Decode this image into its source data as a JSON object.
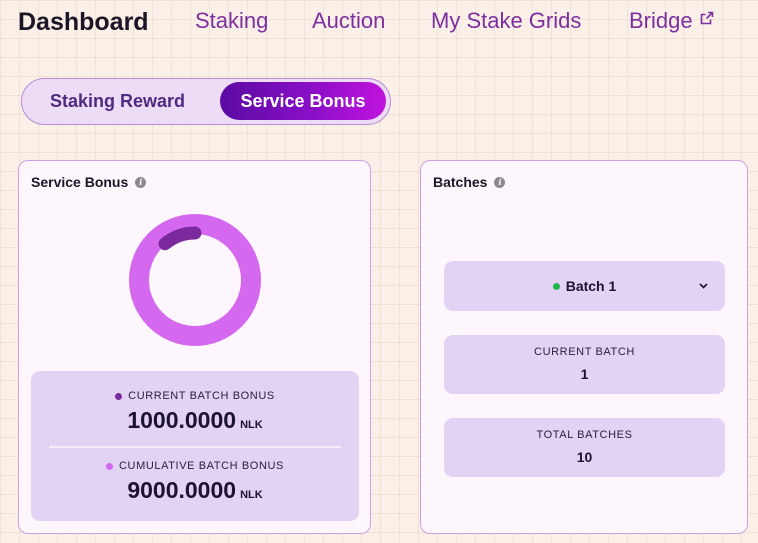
{
  "nav": {
    "title": "Dashboard",
    "links": [
      "Staking",
      "Auction",
      "My Stake Grids",
      "Bridge"
    ]
  },
  "toggle": {
    "options": [
      "Staking Reward",
      "Service Bonus"
    ],
    "selected": "Service Bonus"
  },
  "service_bonus": {
    "title": "Service Bonus",
    "donut": {
      "current_fraction": 0.1,
      "current_color": "#7a2a9c",
      "cumulative_color": "#d469f0"
    },
    "current": {
      "label": "CURRENT BATCH BONUS",
      "value": "1000.0000",
      "unit": "NLK",
      "color": "#7a2a9c"
    },
    "cumulative": {
      "label": "CUMULATIVE BATCH BONUS",
      "value": "9000.0000",
      "unit": "NLK",
      "color": "#d469f0"
    }
  },
  "batches": {
    "title": "Batches",
    "selected": "Batch 1",
    "current": {
      "label": "CURRENT BATCH",
      "value": "1"
    },
    "total": {
      "label": "TOTAL BATCHES",
      "value": "10"
    }
  }
}
